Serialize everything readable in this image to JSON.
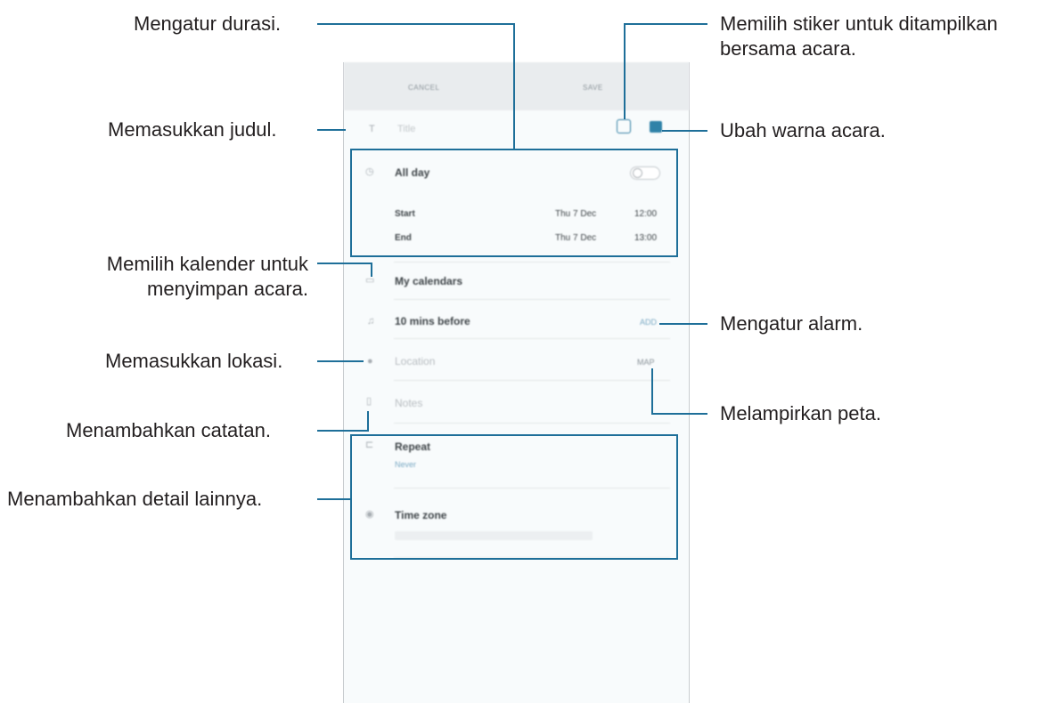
{
  "screen": {
    "cancel": "CANCEL",
    "save": "SAVE",
    "title_placeholder": "Title",
    "all_day": "All day",
    "start_label": "Start",
    "start_date": "Thu 7 Dec",
    "start_time": "12:00",
    "end_label": "End",
    "end_date": "Thu 7 Dec",
    "end_time": "13:00",
    "calendar": "My calendars",
    "reminder": "10 mins before",
    "reminder_add": "ADD",
    "location_placeholder": "Location",
    "map_button": "MAP",
    "notes_placeholder": "Notes",
    "repeat": "Repeat",
    "repeat_value": "Never",
    "time_zone": "Time zone",
    "accent_color": "#2f82a8"
  },
  "callouts": {
    "duration": "Mengatur durasi.",
    "title": "Memasukkan judul.",
    "calendar_line1": "Memilih kalender untuk",
    "calendar_line2": "menyimpan acara.",
    "location": "Memasukkan lokasi.",
    "notes": "Menambahkan catatan.",
    "details": "Menambahkan detail lainnya.",
    "sticker_line1": "Memilih stiker untuk ditampilkan",
    "sticker_line2": "bersama acara.",
    "color": "Ubah warna acara.",
    "alarm": "Mengatur alarm.",
    "map": "Melampirkan peta."
  }
}
